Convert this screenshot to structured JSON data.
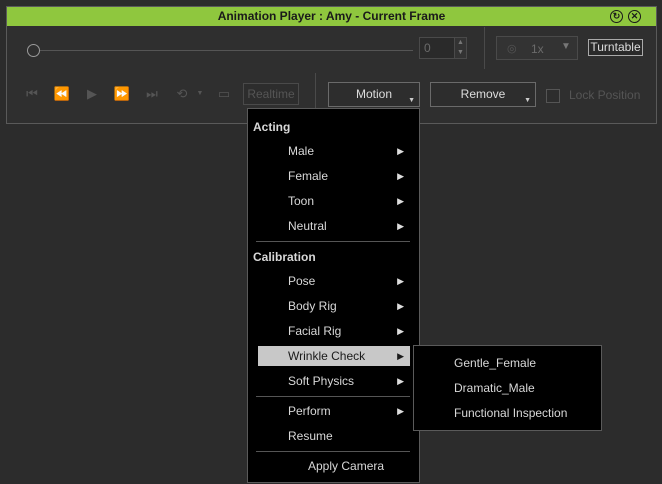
{
  "window": {
    "title": "Animation Player : Amy - Current Frame",
    "refresh_glyph": "↻",
    "close_glyph": "✕"
  },
  "timeline": {
    "frame_value": "0",
    "progress": 0
  },
  "speed": {
    "value": "1x"
  },
  "buttons": {
    "turntable": "Turntable",
    "realtime": "Realtime",
    "motion": "Motion",
    "remove": "Remove",
    "lock_position": "Lock Position"
  },
  "icons": {
    "first_frame": "⏮",
    "prev_frame": "⏪",
    "play": "▶",
    "next_frame": "⏩",
    "last_frame": "⏭",
    "loop": "⟲",
    "subtitle": "▭",
    "eye": "◎",
    "dropdown": "▼",
    "spin_up": "▲",
    "spin_down": "▼",
    "submenu": "▶"
  },
  "menu": {
    "acting_header": "Acting",
    "acting": [
      "Male",
      "Female",
      "Toon",
      "Neutral"
    ],
    "calibration_header": "Calibration",
    "calibration": [
      "Pose",
      "Body Rig",
      "Facial Rig",
      "Wrinkle Check",
      "Soft Physics"
    ],
    "perform": "Perform",
    "resume": "Resume",
    "apply_camera": "Apply Camera"
  },
  "submenu": {
    "items": [
      "Gentle_Female",
      "Dramatic_Male",
      "Functional Inspection"
    ]
  },
  "colors": {
    "title_bar": "#8fc73e",
    "highlight": "#c8c8c8",
    "menu_bg": "#000000"
  }
}
